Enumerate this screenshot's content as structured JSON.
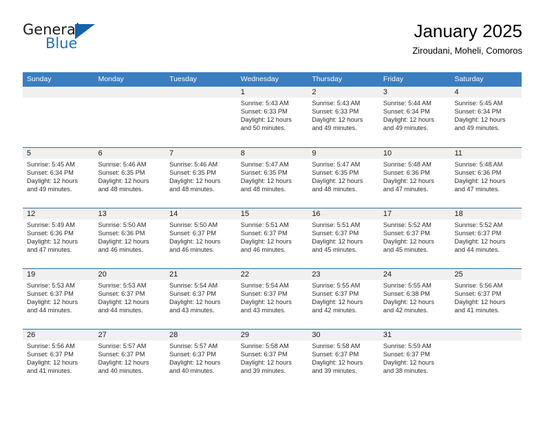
{
  "branding": {
    "logo_text_primary": "General",
    "logo_text_secondary": "Blue",
    "logo_icon": "blue-triangle-icon",
    "accent_color": "#3a7ebf",
    "header_color": "#3a7ebf",
    "row_divider_color": "#2e6da4",
    "day_band_color": "#f0f0f0"
  },
  "header": {
    "title": "January 2025",
    "subtitle": "Ziroudani, Moheli, Comoros"
  },
  "calendar": {
    "weekdays": [
      "Sunday",
      "Monday",
      "Tuesday",
      "Wednesday",
      "Thursday",
      "Friday",
      "Saturday"
    ],
    "weeks": [
      [
        {
          "day": "",
          "empty": true
        },
        {
          "day": "",
          "empty": true
        },
        {
          "day": "",
          "empty": true
        },
        {
          "day": "1",
          "sunrise": "Sunrise: 5:43 AM",
          "sunset": "Sunset: 6:33 PM",
          "daylight1": "Daylight: 12 hours",
          "daylight2": "and 50 minutes."
        },
        {
          "day": "2",
          "sunrise": "Sunrise: 5:43 AM",
          "sunset": "Sunset: 6:33 PM",
          "daylight1": "Daylight: 12 hours",
          "daylight2": "and 49 minutes."
        },
        {
          "day": "3",
          "sunrise": "Sunrise: 5:44 AM",
          "sunset": "Sunset: 6:34 PM",
          "daylight1": "Daylight: 12 hours",
          "daylight2": "and 49 minutes."
        },
        {
          "day": "4",
          "sunrise": "Sunrise: 5:45 AM",
          "sunset": "Sunset: 6:34 PM",
          "daylight1": "Daylight: 12 hours",
          "daylight2": "and 49 minutes."
        }
      ],
      [
        {
          "day": "5",
          "sunrise": "Sunrise: 5:45 AM",
          "sunset": "Sunset: 6:34 PM",
          "daylight1": "Daylight: 12 hours",
          "daylight2": "and 49 minutes."
        },
        {
          "day": "6",
          "sunrise": "Sunrise: 5:46 AM",
          "sunset": "Sunset: 6:35 PM",
          "daylight1": "Daylight: 12 hours",
          "daylight2": "and 48 minutes."
        },
        {
          "day": "7",
          "sunrise": "Sunrise: 5:46 AM",
          "sunset": "Sunset: 6:35 PM",
          "daylight1": "Daylight: 12 hours",
          "daylight2": "and 48 minutes."
        },
        {
          "day": "8",
          "sunrise": "Sunrise: 5:47 AM",
          "sunset": "Sunset: 6:35 PM",
          "daylight1": "Daylight: 12 hours",
          "daylight2": "and 48 minutes."
        },
        {
          "day": "9",
          "sunrise": "Sunrise: 5:47 AM",
          "sunset": "Sunset: 6:35 PM",
          "daylight1": "Daylight: 12 hours",
          "daylight2": "and 48 minutes."
        },
        {
          "day": "10",
          "sunrise": "Sunrise: 5:48 AM",
          "sunset": "Sunset: 6:36 PM",
          "daylight1": "Daylight: 12 hours",
          "daylight2": "and 47 minutes."
        },
        {
          "day": "11",
          "sunrise": "Sunrise: 5:48 AM",
          "sunset": "Sunset: 6:36 PM",
          "daylight1": "Daylight: 12 hours",
          "daylight2": "and 47 minutes."
        }
      ],
      [
        {
          "day": "12",
          "sunrise": "Sunrise: 5:49 AM",
          "sunset": "Sunset: 6:36 PM",
          "daylight1": "Daylight: 12 hours",
          "daylight2": "and 47 minutes."
        },
        {
          "day": "13",
          "sunrise": "Sunrise: 5:50 AM",
          "sunset": "Sunset: 6:36 PM",
          "daylight1": "Daylight: 12 hours",
          "daylight2": "and 46 minutes."
        },
        {
          "day": "14",
          "sunrise": "Sunrise: 5:50 AM",
          "sunset": "Sunset: 6:37 PM",
          "daylight1": "Daylight: 12 hours",
          "daylight2": "and 46 minutes."
        },
        {
          "day": "15",
          "sunrise": "Sunrise: 5:51 AM",
          "sunset": "Sunset: 6:37 PM",
          "daylight1": "Daylight: 12 hours",
          "daylight2": "and 46 minutes."
        },
        {
          "day": "16",
          "sunrise": "Sunrise: 5:51 AM",
          "sunset": "Sunset: 6:37 PM",
          "daylight1": "Daylight: 12 hours",
          "daylight2": "and 45 minutes."
        },
        {
          "day": "17",
          "sunrise": "Sunrise: 5:52 AM",
          "sunset": "Sunset: 6:37 PM",
          "daylight1": "Daylight: 12 hours",
          "daylight2": "and 45 minutes."
        },
        {
          "day": "18",
          "sunrise": "Sunrise: 5:52 AM",
          "sunset": "Sunset: 6:37 PM",
          "daylight1": "Daylight: 12 hours",
          "daylight2": "and 44 minutes."
        }
      ],
      [
        {
          "day": "19",
          "sunrise": "Sunrise: 5:53 AM",
          "sunset": "Sunset: 6:37 PM",
          "daylight1": "Daylight: 12 hours",
          "daylight2": "and 44 minutes."
        },
        {
          "day": "20",
          "sunrise": "Sunrise: 5:53 AM",
          "sunset": "Sunset: 6:37 PM",
          "daylight1": "Daylight: 12 hours",
          "daylight2": "and 44 minutes."
        },
        {
          "day": "21",
          "sunrise": "Sunrise: 5:54 AM",
          "sunset": "Sunset: 6:37 PM",
          "daylight1": "Daylight: 12 hours",
          "daylight2": "and 43 minutes."
        },
        {
          "day": "22",
          "sunrise": "Sunrise: 5:54 AM",
          "sunset": "Sunset: 6:37 PM",
          "daylight1": "Daylight: 12 hours",
          "daylight2": "and 43 minutes."
        },
        {
          "day": "23",
          "sunrise": "Sunrise: 5:55 AM",
          "sunset": "Sunset: 6:37 PM",
          "daylight1": "Daylight: 12 hours",
          "daylight2": "and 42 minutes."
        },
        {
          "day": "24",
          "sunrise": "Sunrise: 5:55 AM",
          "sunset": "Sunset: 6:38 PM",
          "daylight1": "Daylight: 12 hours",
          "daylight2": "and 42 minutes."
        },
        {
          "day": "25",
          "sunrise": "Sunrise: 5:56 AM",
          "sunset": "Sunset: 6:37 PM",
          "daylight1": "Daylight: 12 hours",
          "daylight2": "and 41 minutes."
        }
      ],
      [
        {
          "day": "26",
          "sunrise": "Sunrise: 5:56 AM",
          "sunset": "Sunset: 6:37 PM",
          "daylight1": "Daylight: 12 hours",
          "daylight2": "and 41 minutes."
        },
        {
          "day": "27",
          "sunrise": "Sunrise: 5:57 AM",
          "sunset": "Sunset: 6:37 PM",
          "daylight1": "Daylight: 12 hours",
          "daylight2": "and 40 minutes."
        },
        {
          "day": "28",
          "sunrise": "Sunrise: 5:57 AM",
          "sunset": "Sunset: 6:37 PM",
          "daylight1": "Daylight: 12 hours",
          "daylight2": "and 40 minutes."
        },
        {
          "day": "29",
          "sunrise": "Sunrise: 5:58 AM",
          "sunset": "Sunset: 6:37 PM",
          "daylight1": "Daylight: 12 hours",
          "daylight2": "and 39 minutes."
        },
        {
          "day": "30",
          "sunrise": "Sunrise: 5:58 AM",
          "sunset": "Sunset: 6:37 PM",
          "daylight1": "Daylight: 12 hours",
          "daylight2": "and 39 minutes."
        },
        {
          "day": "31",
          "sunrise": "Sunrise: 5:59 AM",
          "sunset": "Sunset: 6:37 PM",
          "daylight1": "Daylight: 12 hours",
          "daylight2": "and 38 minutes."
        },
        {
          "day": "",
          "empty": true
        }
      ]
    ]
  }
}
